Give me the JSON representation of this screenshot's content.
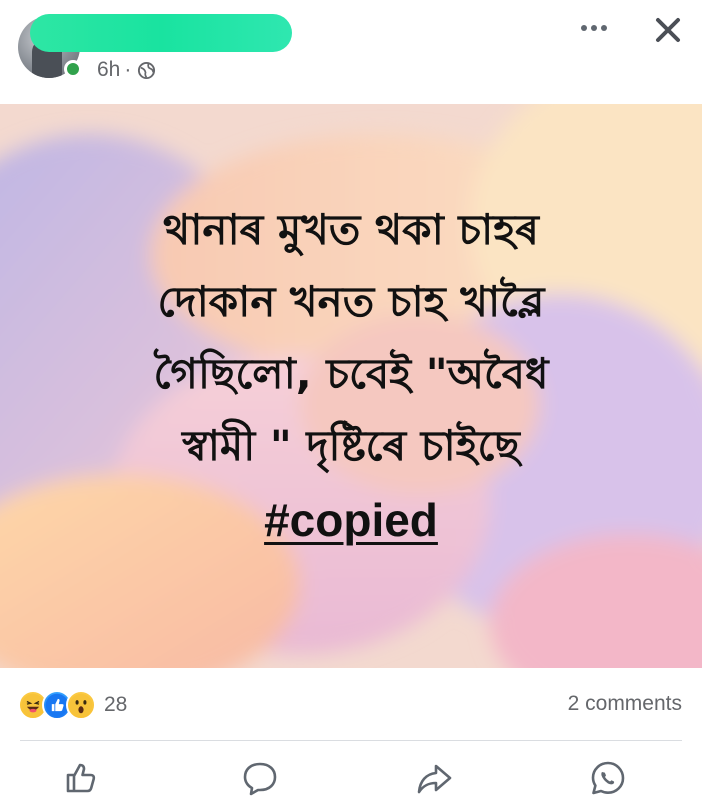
{
  "header": {
    "author_name": "",
    "timestamp": "6h",
    "separator": "·",
    "privacy_icon": "globe-icon",
    "more_icon": "more-options-icon",
    "close_icon": "close-icon"
  },
  "post": {
    "lines": [
      "থানাৰ মুখত থকা চাহৰ",
      "দোকান খনত চাহ খাব্লৈ",
      "গৈছিলো, চবেই \"অবৈধ",
      "স্বামী \" দৃষ্টিৰে চাইছে"
    ],
    "hashtag": "#copied"
  },
  "stats": {
    "reaction_icons": [
      "haha-icon",
      "like-icon",
      "wow-icon"
    ],
    "reaction_count": "28",
    "comments_label": "2 comments"
  },
  "actions": {
    "icons": [
      "like-icon",
      "comment-icon",
      "share-icon",
      "whatsapp-icon"
    ]
  },
  "colors": {
    "online": "#31a24c",
    "like_blue": "#1877f2",
    "meta_gray": "#65676b",
    "name_redaction": "#19e3a0"
  }
}
